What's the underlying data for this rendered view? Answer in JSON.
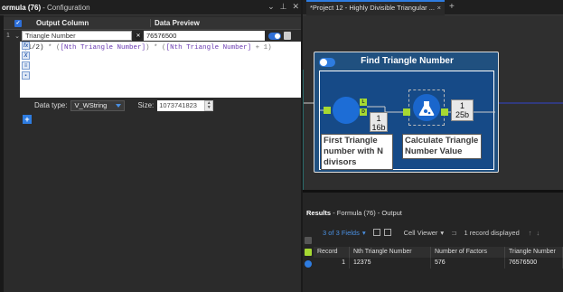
{
  "config": {
    "title_bold": "ormula (76)",
    "title_rest": "- Configuration",
    "headers": {
      "output_column": "Output Column",
      "data_preview": "Data Preview"
    },
    "row": {
      "number": "1",
      "name": "Triangle Number",
      "preview": "76576500"
    },
    "expression": {
      "open": "(1/2)",
      "op1": " * (",
      "field1": "[Nth Triangle Number]",
      "op2": ") * (",
      "field2": "[Nth Triangle Number]",
      "op3": " + 1)"
    },
    "data_type_label": "Data type:",
    "data_type_value": "V_WString",
    "size_label": "Size:",
    "size_value": "1073741823",
    "add_label": "+"
  },
  "tab": {
    "label": "*Project 12 - Highly Divisible Triangular ...",
    "close": "×",
    "plus": "+"
  },
  "canvas": {
    "macro_title": "Find Triangle Number",
    "tool1": {
      "label": "First Triangle number with N divisors",
      "badge_count": "1",
      "badge_size": "16b",
      "port_l": "L",
      "port_d": "D"
    },
    "tool2": {
      "label": "Calculate Triangle Number Value",
      "badge_count": "1",
      "badge_size": "25b"
    }
  },
  "results": {
    "title_bold": "Results",
    "title_rest": "- Formula (76) - Output",
    "fields_label": "3 of 3 Fields",
    "viewer_label": "Cell Viewer",
    "records_label": "1 record displayed",
    "columns": [
      "Record",
      "Nth Triangle Number",
      "Number of Factors",
      "Triangle Number"
    ],
    "rows": [
      [
        "1",
        "12375",
        "576",
        "76576500"
      ]
    ]
  },
  "colors": {
    "accent": "#2e7ce0",
    "macro_bg": "#20507f",
    "port_green": "#a6d932"
  }
}
